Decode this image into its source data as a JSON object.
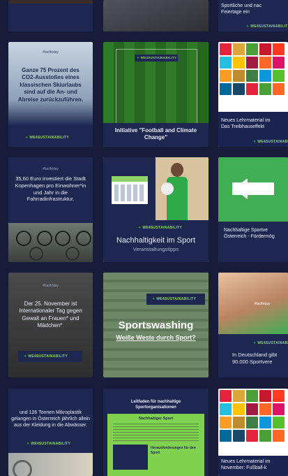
{
  "brand": "WE4SUSTAINABILITY",
  "tiles": {
    "r0c0": {},
    "r0c1": {},
    "r0c2": {
      "text": "Sportliche und nac\nFeiertage ein"
    },
    "r1c0": {
      "tag": "#factfriday",
      "text": "Ganze 75 Prozent des CO2-Ausstoßes eines klassischen Skiurlaubs sind auf die An- und Abreise zurückzuführen."
    },
    "r1c1": {
      "text": "Initiative \"Football and Climate Change\""
    },
    "r1c2": {
      "text": "Neues Lehrmaterial im\nDas Treibhauseffekt"
    },
    "r2c0": {
      "tag": "#factfriday",
      "text": "35,60 Euro investiert die Stadt Kopenhagen pro Einwohner*in und Jahr in die Fahrradinfrastruktur."
    },
    "r2c1": {
      "title": "Nachhaltigkeit im Sport",
      "subtitle": "Veranstaltungstipps"
    },
    "r2c2": {
      "text": "Nachhaltige Sportve\nÖsterreich - Fördermög"
    },
    "r3c0": {
      "tag": "#factfriday",
      "text": "Der 25. November ist Internationaler Tag gegen Gewalt an Frauen* und Mädchen*."
    },
    "r3c1": {
      "title": "Sportswashing",
      "subtitle": "Weiße Weste durch Sport?"
    },
    "r3c2": {
      "tag": "#factfriday",
      "text": "In Deutschland gibt\n90.000 Sportvere"
    },
    "r4c0": {
      "text": "und 126 Tonnen Mikroplastik gelangen in Österreich jährlich allein aus der Kleidung in die Abwässer."
    },
    "r4c1": {
      "title": "Leitfaden für nachhaltige Sportorganisationen",
      "heading": "Nachhaltiger Sport",
      "box": "Herausforderungen für den Sport"
    },
    "r4c2": {
      "text": "Neues Lehrmaterial im\nNovember: Fußball-k"
    }
  },
  "sdg_colors": [
    "#e5243b",
    "#dda63a",
    "#4c9f38",
    "#c5192d",
    "#ff3a21",
    "#26bde2",
    "#fcc30b",
    "#a21942",
    "#fd6925",
    "#dd1367",
    "#fd9d24",
    "#bf8b2e",
    "#3f7e44",
    "#0a97d9",
    "#56c02b",
    "#00689d",
    "#19486a",
    "#e5243b",
    "#4c9f38",
    "#fd6925"
  ]
}
